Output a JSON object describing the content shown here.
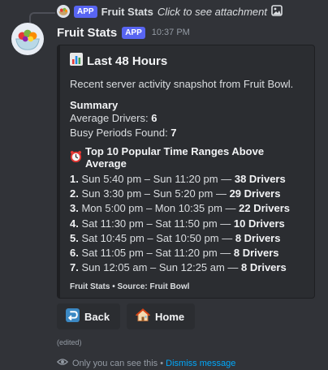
{
  "reply": {
    "badge": "APP",
    "name": "Fruit Stats",
    "text": "Click to see attachment"
  },
  "message": {
    "author": "Fruit Stats",
    "badge": "APP",
    "timestamp": "10:37 PM"
  },
  "embed": {
    "title": "Last 48 Hours",
    "description": "Recent server activity snapshot from Fruit Bowl.",
    "summary_title": "Summary",
    "average_drivers_label": "Average Drivers: ",
    "average_drivers_value": "6",
    "busy_periods_label": "Busy Periods Found: ",
    "busy_periods_value": "7",
    "ranges_title": "Top 10 Popular Time Ranges Above Average",
    "ranges": [
      {
        "num": "1.",
        "range": "Sun 5:40 pm – Sun 11:20 pm — ",
        "drivers": "38 Drivers"
      },
      {
        "num": "2.",
        "range": "Sun 3:30 pm – Sun 5:20 pm — ",
        "drivers": "29 Drivers"
      },
      {
        "num": "3.",
        "range": "Mon 5:00 pm – Mon 10:35 pm — ",
        "drivers": "22 Drivers"
      },
      {
        "num": "4.",
        "range": "Sat 11:30 pm – Sat 11:50 pm — ",
        "drivers": "10 Drivers"
      },
      {
        "num": "5.",
        "range": "Sat 10:45 pm – Sat 10:50 pm — ",
        "drivers": "8 Drivers"
      },
      {
        "num": "6.",
        "range": "Sat 11:05 pm – Sat 11:20 pm — ",
        "drivers": "8 Drivers"
      },
      {
        "num": "7.",
        "range": "Sun 12:05 am – Sun 12:25 am — ",
        "drivers": "8 Drivers"
      }
    ],
    "footer": "Fruit Stats • Source: Fruit Bowl"
  },
  "buttons": {
    "back": "Back",
    "home": "Home"
  },
  "edited": "(edited)",
  "ephemeral": {
    "text": "Only you can see this • ",
    "dismiss": "Dismiss message"
  },
  "colors": {
    "background": "#313338",
    "embed": "#2b2d31",
    "badge": "#5865f2",
    "link": "#00a8fc"
  },
  "icons": {
    "title": "bar-chart-icon",
    "ranges": "alarm-clock-icon",
    "back": "return-arrow-icon",
    "home": "house-icon",
    "attachment": "image-icon",
    "ephemeral": "eye-icon"
  }
}
